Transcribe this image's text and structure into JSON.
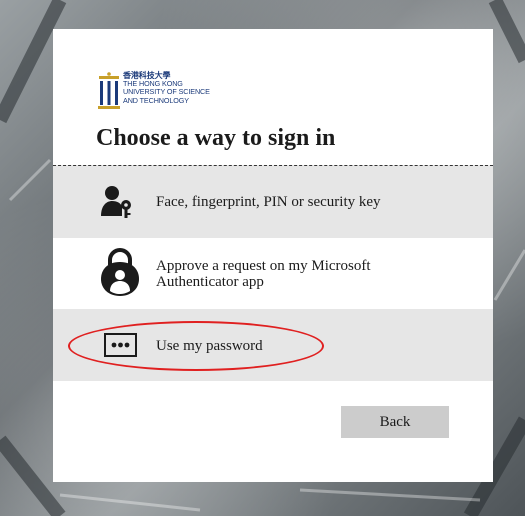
{
  "logo": {
    "chinese_name": "香港科技大學",
    "english_lines": [
      "THE HONG KONG",
      "UNIVERSITY OF SCIENCE",
      "AND TECHNOLOGY"
    ]
  },
  "title": "Choose a way to sign in",
  "options": [
    {
      "label": "Face, fingerprint, PIN or security key",
      "icon": "user-key-icon"
    },
    {
      "label_line1": "Approve a request on my Microsoft",
      "label_line2": "Authenticator app",
      "icon": "authenticator-lock-icon"
    },
    {
      "label": "Use my password",
      "icon": "password-dots-icon"
    }
  ],
  "back_label": "Back",
  "colors": {
    "highlight": "#e02020",
    "option_bg": "#e6e6e6",
    "button_bg": "#cccccc",
    "logo_blue": "#1b3a7a",
    "logo_gold": "#c8a02a"
  }
}
